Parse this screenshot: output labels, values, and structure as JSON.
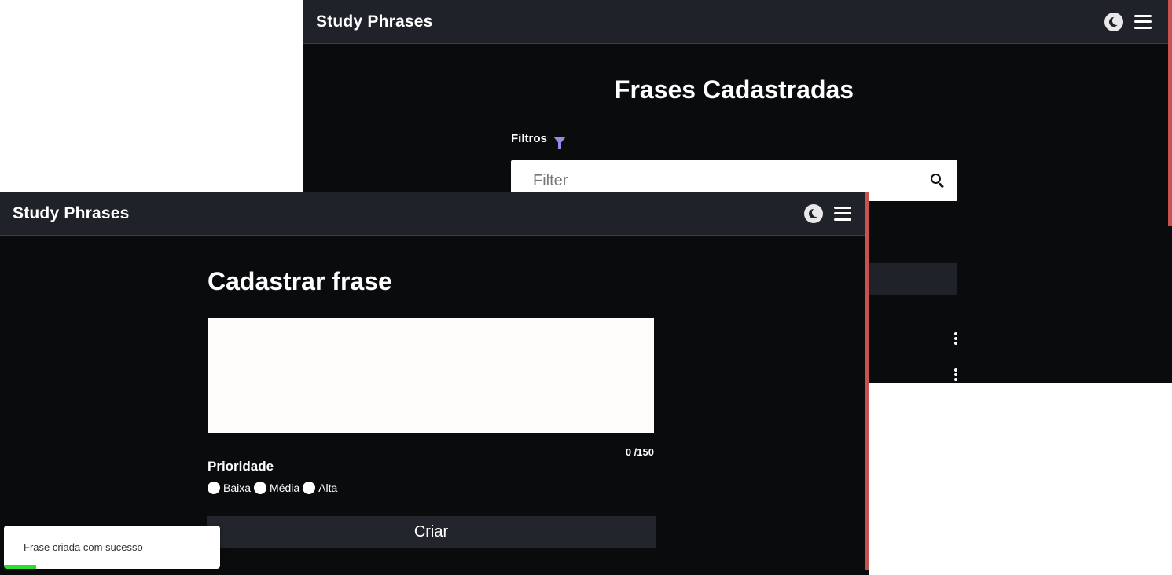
{
  "back_window": {
    "navbar": {
      "brand": "Study Phrases"
    },
    "title": "Frases Cadastradas",
    "filters": {
      "label": "Filtros",
      "placeholder": "Filter",
      "value": ""
    }
  },
  "front_window": {
    "navbar": {
      "brand": "Study Phrases"
    },
    "title": "Cadastrar frase",
    "textarea": {
      "value": "",
      "counter": "0 /150"
    },
    "priority": {
      "label": "Prioridade",
      "options": [
        "Baixa",
        "Média",
        "Alta"
      ]
    },
    "create_label": "Criar"
  },
  "toast": {
    "message": "Frase criada com sucesso",
    "progress": 0.15,
    "progress_color": "#2ddc2d"
  },
  "colors": {
    "navbar_bg": "#1f2329",
    "page_bg": "#0a0b0d",
    "scroll_accent": "#c9524f",
    "filter_icon": "#9b87e6"
  },
  "icons": [
    "theme-toggle-icon",
    "hamburger-menu-icon",
    "filter-funnel-icon",
    "search-icon",
    "kebab-menu-icon"
  ]
}
